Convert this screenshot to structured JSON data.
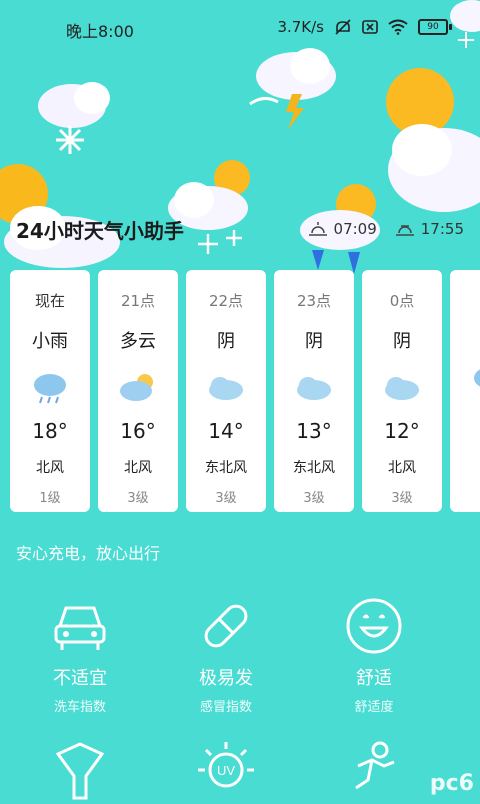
{
  "status_bar": {
    "time": "晚上8:00",
    "speed": "3.7K/s",
    "battery": "90"
  },
  "header": {
    "title": "24小时天气小助手",
    "sunrise": "07:09",
    "sunset": "17:55"
  },
  "hourly": [
    {
      "time": "现在",
      "condition": "小雨",
      "icon": "light-rain-icon",
      "temp": "18°",
      "wind": "北风",
      "level": "1级"
    },
    {
      "time": "21点",
      "condition": "多云",
      "icon": "partly-cloudy-icon",
      "temp": "16°",
      "wind": "北风",
      "level": "3级"
    },
    {
      "time": "22点",
      "condition": "阴",
      "icon": "overcast-icon",
      "temp": "14°",
      "wind": "东北风",
      "level": "3级"
    },
    {
      "time": "23点",
      "condition": "阴",
      "icon": "overcast-icon",
      "temp": "13°",
      "wind": "东北风",
      "level": "3级"
    },
    {
      "time": "0点",
      "condition": "阴",
      "icon": "overcast-icon",
      "temp": "12°",
      "wind": "北风",
      "level": "3级"
    }
  ],
  "tagline": "安心充电，放心出行",
  "indices": [
    {
      "value": "不适宜",
      "label": "洗车指数",
      "icon": "car-icon"
    },
    {
      "value": "极易发",
      "label": "感冒指数",
      "icon": "pill-icon"
    },
    {
      "value": "舒适",
      "label": "舒适度",
      "icon": "smiley-icon"
    }
  ],
  "indices_row2_icons": [
    "scarf-icon",
    "uv-icon",
    "running-icon"
  ],
  "watermark": "pc6",
  "colors": {
    "background": "#48dcd3",
    "card": "#ffffff"
  }
}
